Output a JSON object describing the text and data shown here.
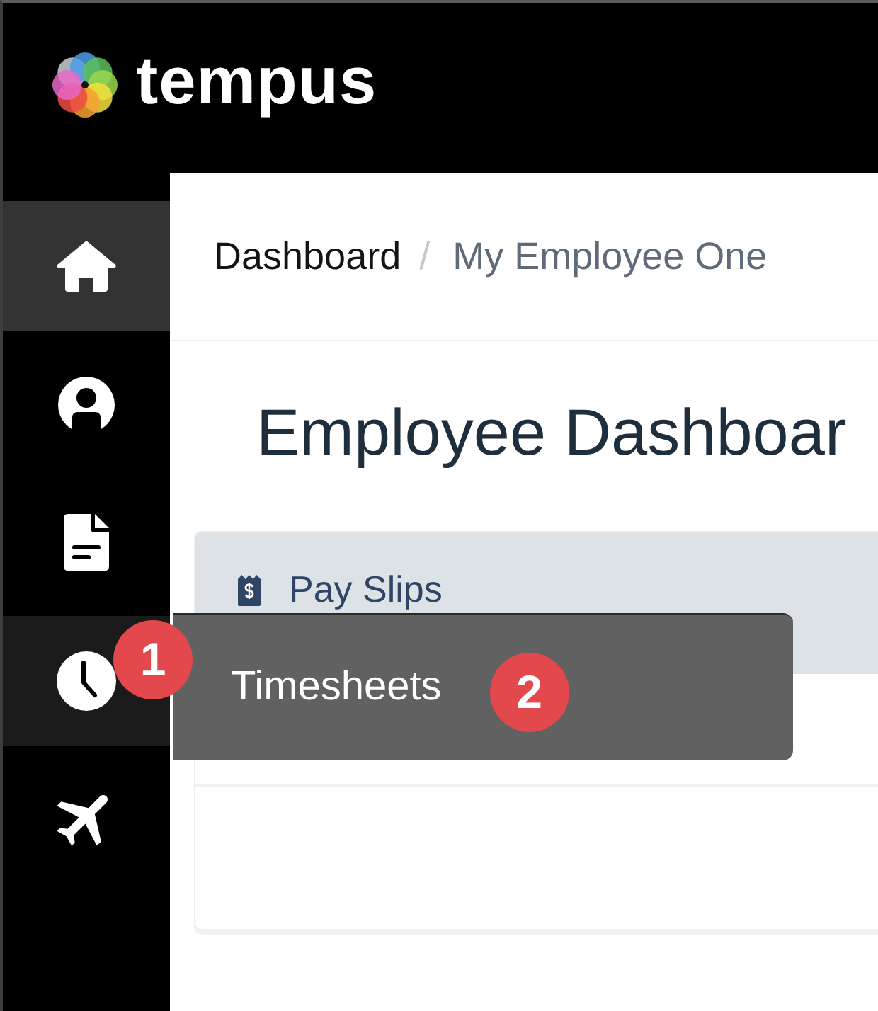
{
  "header": {
    "logo_text": "tempus"
  },
  "sidebar": {
    "items": [
      {
        "kind": "home",
        "selected": true,
        "hovered": false
      },
      {
        "kind": "profile",
        "selected": false,
        "hovered": false
      },
      {
        "kind": "document",
        "selected": false,
        "hovered": false
      },
      {
        "kind": "clock",
        "selected": false,
        "hovered": true,
        "badge": "1",
        "flyout": {
          "label": "Timesheets",
          "badge": "2"
        }
      },
      {
        "kind": "plane",
        "selected": false,
        "hovered": false
      }
    ]
  },
  "breadcrumb": {
    "separator": "/",
    "items": [
      {
        "label": "Dashboard",
        "current": false
      },
      {
        "label": "My Employee One",
        "current": true
      }
    ]
  },
  "page_title": "Employee Dashboar",
  "card": {
    "title": "Pay Slips"
  }
}
